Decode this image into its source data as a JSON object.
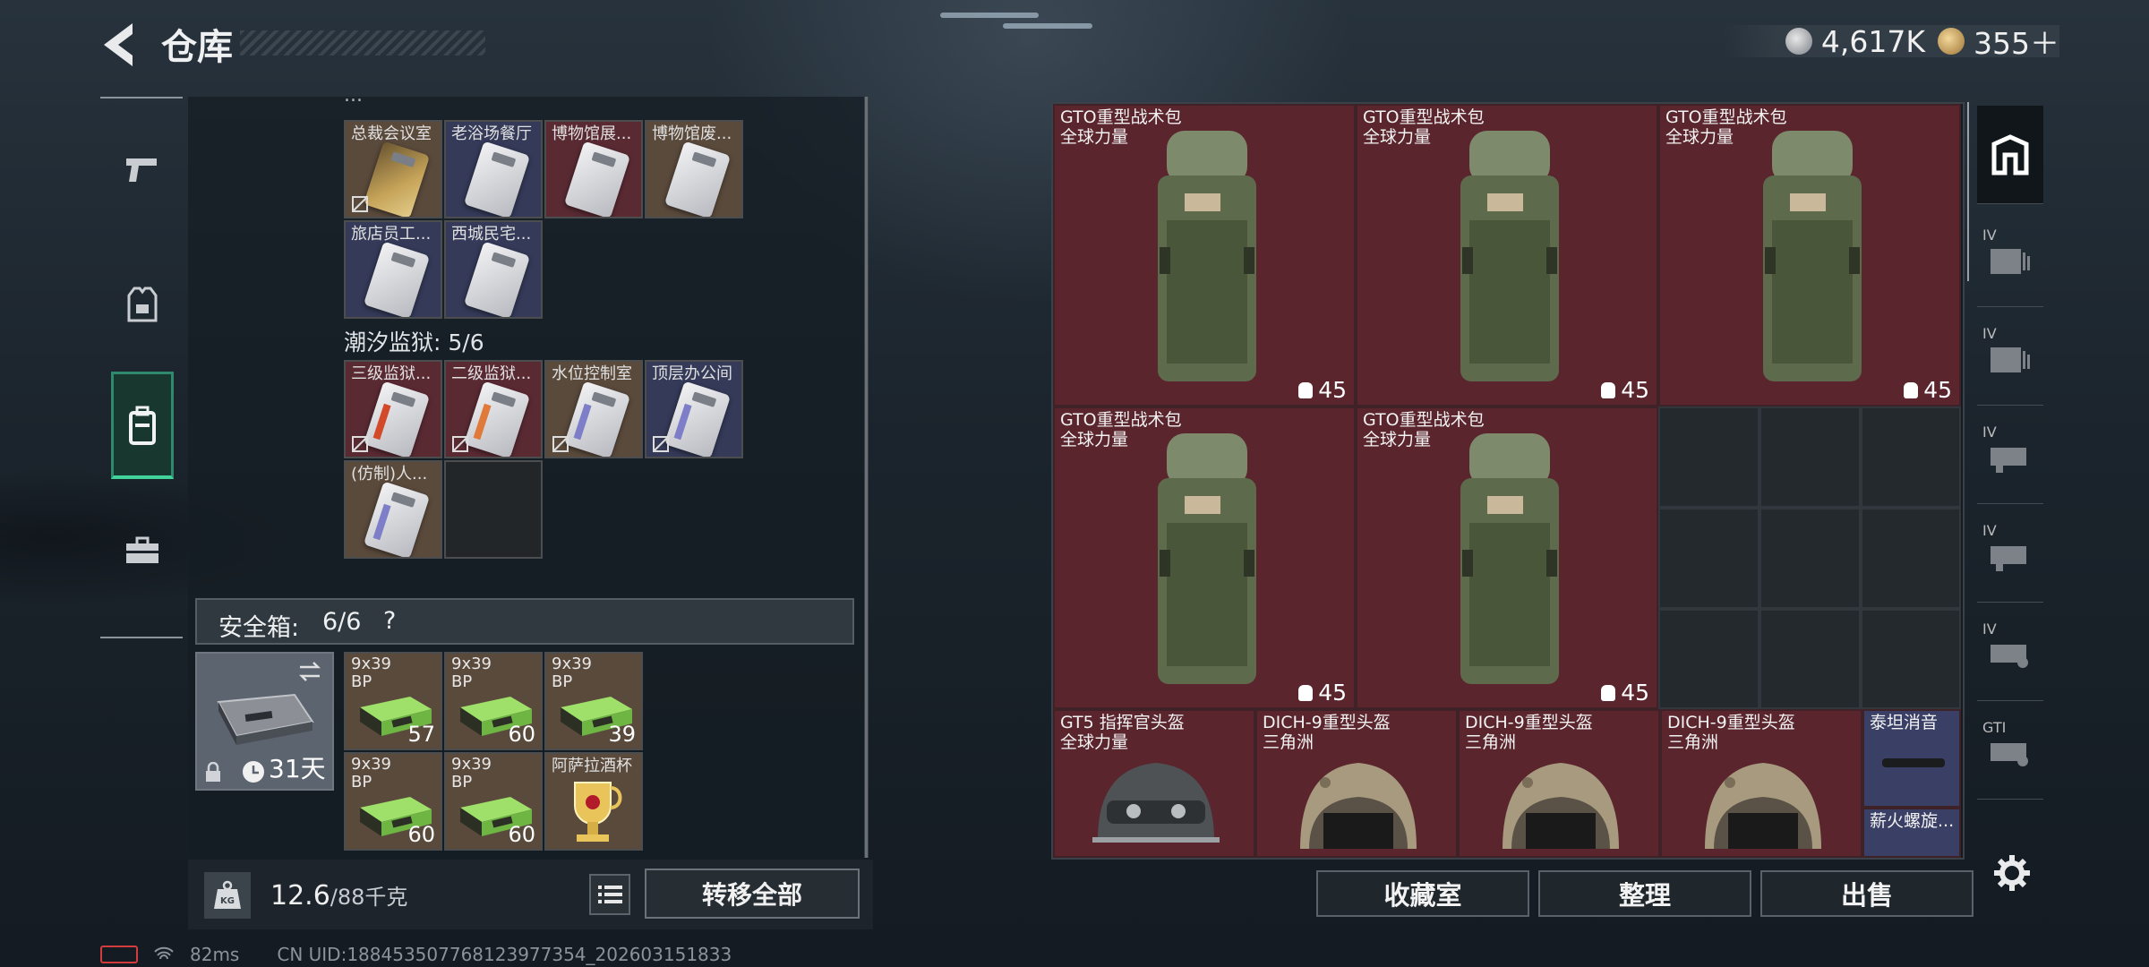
{
  "header": {
    "title": "仓库",
    "currency_silver": "4,617K",
    "currency_gold": "355＋"
  },
  "left_nav": [
    "weapons",
    "armor",
    "backpack",
    "toolbox"
  ],
  "stash_sections": [
    {
      "title": "",
      "items": [
        {
          "label": "总裁会议室",
          "tint": "gold"
        },
        {
          "label": "老浴场餐厅",
          "tint": "blue"
        },
        {
          "label": "博物馆展...",
          "tint": "red"
        },
        {
          "label": "博物馆废...",
          "tint": "gold"
        },
        {
          "label": "旅店员工...",
          "tint": "blue"
        },
        {
          "label": "西城民宅...",
          "tint": "blue"
        }
      ]
    },
    {
      "title": "潮汐监狱: 5/6",
      "items": [
        {
          "label": "三级监狱...",
          "tint": "red"
        },
        {
          "label": "二级监狱...",
          "tint": "red"
        },
        {
          "label": "水位控制室",
          "tint": "gold"
        },
        {
          "label": "顶层办公间",
          "tint": "blue"
        },
        {
          "label": "(仿制)人...",
          "tint": "gold"
        }
      ]
    }
  ],
  "safebox": {
    "title": "安全箱:",
    "count": "6/6",
    "help": "?",
    "days": "31天",
    "items": [
      {
        "line1": "9x39",
        "line2": "BP",
        "qty": "57"
      },
      {
        "line1": "9x39",
        "line2": "BP",
        "qty": "60"
      },
      {
        "line1": "9x39",
        "line2": "BP",
        "qty": "39"
      },
      {
        "line1": "9x39",
        "line2": "BP",
        "qty": "60"
      },
      {
        "line1": "9x39",
        "line2": "BP",
        "qty": "60"
      },
      {
        "line1": "阿萨拉酒杯",
        "line2": "",
        "qty": ""
      }
    ]
  },
  "weight": {
    "current": "12.6",
    "max": "/88千克"
  },
  "transfer_all": "转移全部",
  "stash_right": {
    "backpacks": [
      {
        "name": "GTO重型战术包",
        "sub": "全球力量",
        "cap": "45"
      },
      {
        "name": "GTO重型战术包",
        "sub": "全球力量",
        "cap": "45"
      },
      {
        "name": "GTO重型战术包",
        "sub": "全球力量",
        "cap": "45"
      },
      {
        "name": "GTO重型战术包",
        "sub": "全球力量",
        "cap": "45"
      },
      {
        "name": "GTO重型战术包",
        "sub": "全球力量",
        "cap": "45"
      }
    ],
    "helmets": [
      {
        "name": "GT5 指挥官头盔",
        "sub": "全球力量"
      },
      {
        "name": "DICH-9重型头盔",
        "sub": "三角洲"
      },
      {
        "name": "DICH-9重型头盔",
        "sub": "三角洲"
      },
      {
        "name": "DICH-9重型头盔",
        "sub": "三角洲"
      }
    ],
    "suppressor": {
      "name": "泰坦消音",
      "name2": "薪火螺旋..."
    }
  },
  "right_sidebar": [
    {
      "icon": "stash-icon",
      "tier": ""
    },
    {
      "icon": "container-iv-icon",
      "tier": "IV"
    },
    {
      "icon": "container-iv-icon",
      "tier": "IV"
    },
    {
      "icon": "container-iv-icon",
      "tier": "IV"
    },
    {
      "icon": "container-iv-icon",
      "tier": "IV"
    },
    {
      "icon": "container-iv-icon",
      "tier": "IV"
    },
    {
      "icon": "container-gti-icon",
      "tier": "GTI"
    }
  ],
  "actions": {
    "collection": "收藏室",
    "sort": "整理",
    "sell": "出售"
  },
  "status": {
    "ping": "82ms",
    "uid": "CN UID:188453507768123977354_202603151833"
  },
  "colors": {
    "accent_green": "#40d49b",
    "tile_red": "#5a252d",
    "cell_gold": "#5a4a3c",
    "cell_blue": "#343a58"
  }
}
